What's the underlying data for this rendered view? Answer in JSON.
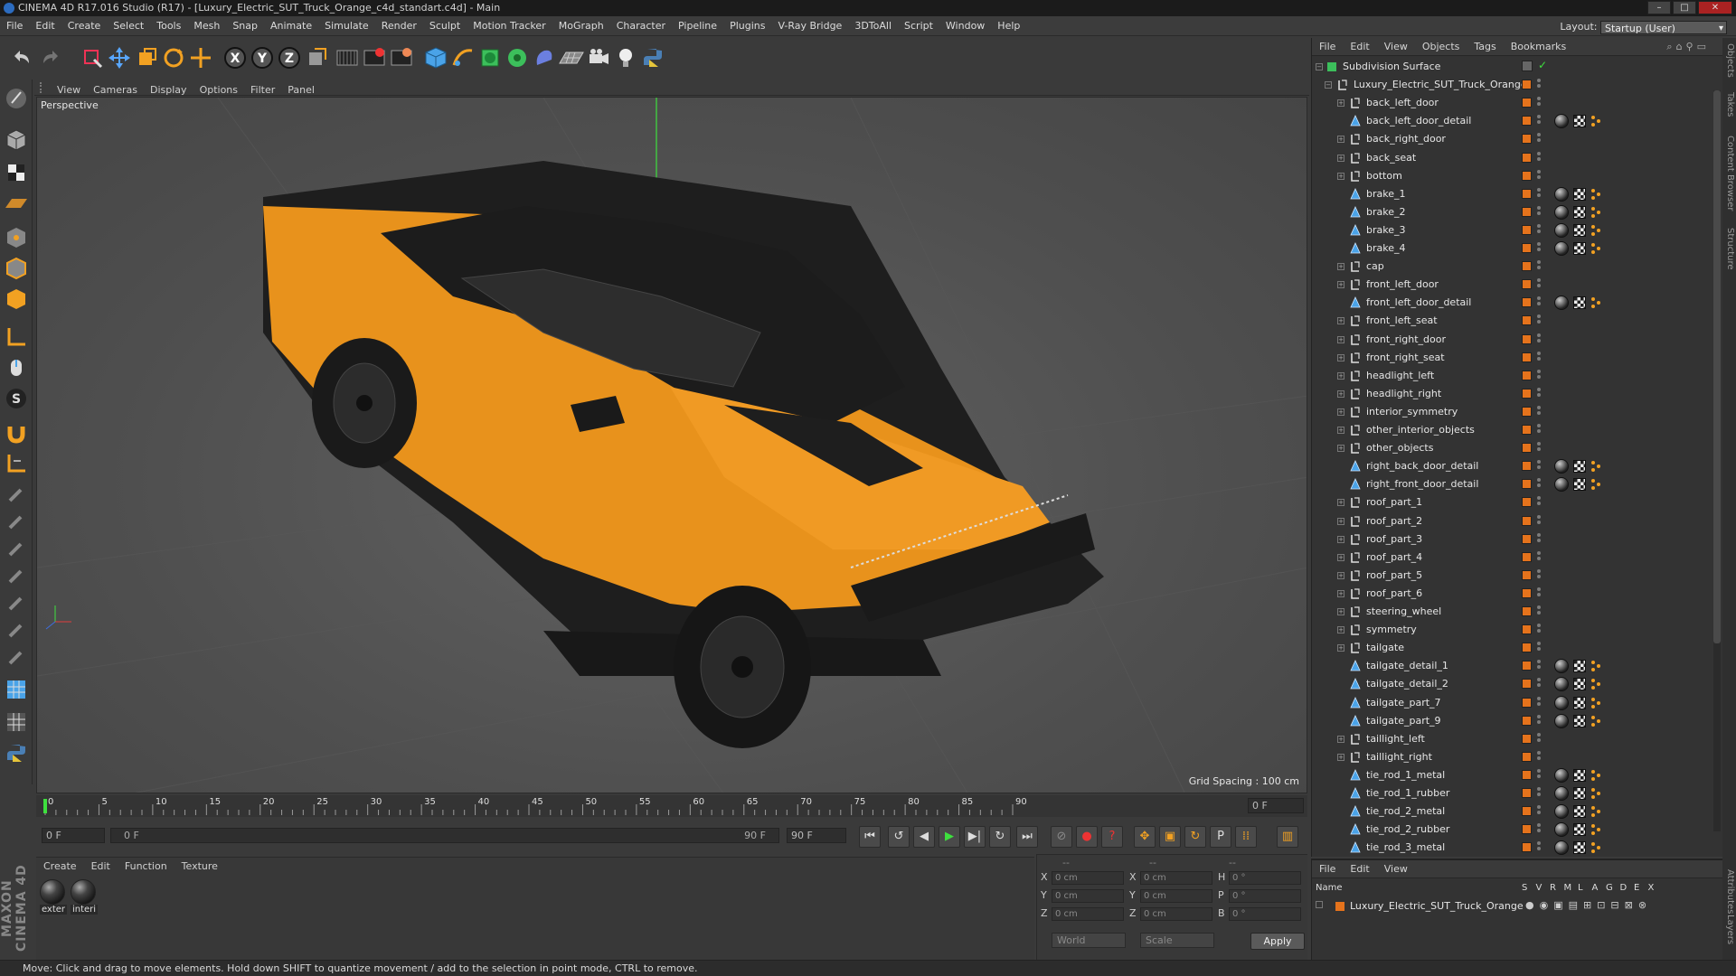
{
  "window": {
    "title": "CINEMA 4D R17.016 Studio (R17) - [Luxury_Electric_SUT_Truck_Orange_c4d_standart.c4d] - Main"
  },
  "menubar": [
    "File",
    "Edit",
    "Create",
    "Select",
    "Tools",
    "Mesh",
    "Snap",
    "Animate",
    "Simulate",
    "Render",
    "Sculpt",
    "Motion Tracker",
    "MoGraph",
    "Character",
    "Pipeline",
    "Plugins",
    "V-Ray Bridge",
    "3DToAll",
    "Script",
    "Window",
    "Help"
  ],
  "layout": {
    "label": "Layout:",
    "value": "Startup (User)"
  },
  "viewport": {
    "menu": [
      "View",
      "Cameras",
      "Display",
      "Options",
      "Filter",
      "Panel"
    ],
    "label": "Perspective",
    "grid_spacing": "Grid Spacing : 100 cm"
  },
  "timeline": {
    "ticks": [
      "0",
      "5",
      "10",
      "15",
      "20",
      "25",
      "30",
      "35",
      "40",
      "45",
      "50",
      "55",
      "60",
      "65",
      "70",
      "75",
      "80",
      "85",
      "90"
    ],
    "current_frame": "0 F",
    "start_field": "0 F",
    "range_start": "0 F",
    "range_end": "90 F",
    "end_field": "90 F"
  },
  "material_manager": {
    "menu": [
      "Create",
      "Edit",
      "Function",
      "Texture"
    ],
    "materials": [
      {
        "label": "exter"
      },
      {
        "label": "interi"
      }
    ]
  },
  "coords": {
    "header": [
      "--",
      "--",
      "--"
    ],
    "rows": [
      {
        "a": "X",
        "av": "0 cm",
        "b": "X",
        "bv": "0 cm",
        "c": "H",
        "cv": "0 °"
      },
      {
        "a": "Y",
        "av": "0 cm",
        "b": "Y",
        "bv": "0 cm",
        "c": "P",
        "cv": "0 °"
      },
      {
        "a": "Z",
        "av": "0 cm",
        "b": "Z",
        "bv": "0 cm",
        "c": "B",
        "cv": "0 °"
      }
    ],
    "mode": "World",
    "scale": "Scale",
    "apply": "Apply"
  },
  "objects": {
    "menu": [
      "File",
      "Edit",
      "View",
      "Objects",
      "Tags",
      "Bookmarks"
    ],
    "root": "Subdivision Surface",
    "group": "Luxury_Electric_SUT_Truck_Orange",
    "items": [
      {
        "name": "back_left_door",
        "type": "null",
        "tags": false
      },
      {
        "name": "back_left_door_detail",
        "type": "poly",
        "tags": true
      },
      {
        "name": "back_right_door",
        "type": "null",
        "tags": false
      },
      {
        "name": "back_seat",
        "type": "null",
        "tags": false
      },
      {
        "name": "bottom",
        "type": "null",
        "tags": false
      },
      {
        "name": "brake_1",
        "type": "poly",
        "tags": true
      },
      {
        "name": "brake_2",
        "type": "poly",
        "tags": true
      },
      {
        "name": "brake_3",
        "type": "poly",
        "tags": true
      },
      {
        "name": "brake_4",
        "type": "poly",
        "tags": true
      },
      {
        "name": "cap",
        "type": "null",
        "tags": false
      },
      {
        "name": "front_left_door",
        "type": "null",
        "tags": false
      },
      {
        "name": "front_left_door_detail",
        "type": "poly",
        "tags": true
      },
      {
        "name": "front_left_seat",
        "type": "null",
        "tags": false
      },
      {
        "name": "front_right_door",
        "type": "null",
        "tags": false
      },
      {
        "name": "front_right_seat",
        "type": "null",
        "tags": false
      },
      {
        "name": "headlight_left",
        "type": "null",
        "tags": false
      },
      {
        "name": "headlight_right",
        "type": "null",
        "tags": false
      },
      {
        "name": "interior_symmetry",
        "type": "null",
        "tags": false
      },
      {
        "name": "other_interior_objects",
        "type": "null",
        "tags": false
      },
      {
        "name": "other_objects",
        "type": "null",
        "tags": false
      },
      {
        "name": "right_back_door_detail",
        "type": "poly",
        "tags": true
      },
      {
        "name": "right_front_door_detail",
        "type": "poly",
        "tags": true
      },
      {
        "name": "roof_part_1",
        "type": "null",
        "tags": false
      },
      {
        "name": "roof_part_2",
        "type": "null",
        "tags": false
      },
      {
        "name": "roof_part_3",
        "type": "null",
        "tags": false
      },
      {
        "name": "roof_part_4",
        "type": "null",
        "tags": false
      },
      {
        "name": "roof_part_5",
        "type": "null",
        "tags": false
      },
      {
        "name": "roof_part_6",
        "type": "null",
        "tags": false
      },
      {
        "name": "steering_wheel",
        "type": "null",
        "tags": false
      },
      {
        "name": "symmetry",
        "type": "null",
        "tags": false
      },
      {
        "name": "tailgate",
        "type": "null",
        "tags": false
      },
      {
        "name": "tailgate_detail_1",
        "type": "poly",
        "tags": true
      },
      {
        "name": "tailgate_detail_2",
        "type": "poly",
        "tags": true
      },
      {
        "name": "tailgate_part_7",
        "type": "poly",
        "tags": true
      },
      {
        "name": "tailgate_part_9",
        "type": "poly",
        "tags": true
      },
      {
        "name": "taillight_left",
        "type": "null",
        "tags": false
      },
      {
        "name": "taillight_right",
        "type": "null",
        "tags": false
      },
      {
        "name": "tie_rod_1_metal",
        "type": "poly",
        "tags": true
      },
      {
        "name": "tie_rod_1_rubber",
        "type": "poly",
        "tags": true
      },
      {
        "name": "tie_rod_2_metal",
        "type": "poly",
        "tags": true
      },
      {
        "name": "tie_rod_2_rubber",
        "type": "poly",
        "tags": true
      },
      {
        "name": "tie_rod_3_metal",
        "type": "poly",
        "tags": true
      }
    ]
  },
  "layers": {
    "menu": [
      "File",
      "Edit",
      "View"
    ],
    "columns": [
      "Name",
      "S",
      "V",
      "R",
      "M",
      "L",
      "A",
      "G",
      "D",
      "E",
      "X"
    ],
    "row": "Luxury_Electric_SUT_Truck_Orange"
  },
  "right_tabs": [
    "Objects",
    "Takes",
    "Content Browser",
    "Structure",
    "Attributes",
    "Layers"
  ],
  "status": "Move: Click and drag to move elements. Hold down SHIFT to quantize movement / add to the selection in point mode, CTRL to remove.",
  "colors": {
    "accent": "#e5731c",
    "background": "#3a3a3a",
    "panel": "#333333"
  }
}
